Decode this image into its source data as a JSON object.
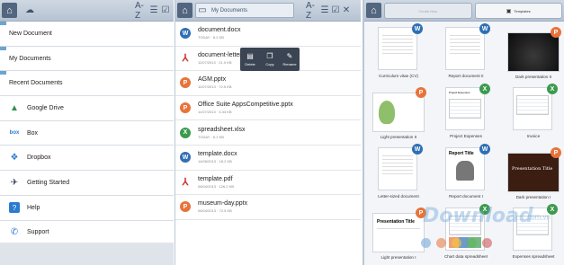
{
  "left": {
    "sections": [
      {
        "label": "New Document"
      },
      {
        "label": "My Documents"
      },
      {
        "label": "Recent Documents"
      }
    ],
    "services": [
      {
        "label": "Google Drive",
        "icon": "google-drive-icon"
      },
      {
        "label": "Box",
        "icon": "box-icon"
      },
      {
        "label": "Dropbox",
        "icon": "dropbox-icon"
      },
      {
        "label": "Getting Started",
        "icon": "person-icon"
      },
      {
        "label": "Help",
        "icon": "help-icon"
      },
      {
        "label": "Support",
        "icon": "phone-icon"
      }
    ],
    "sort_label": "A-Z"
  },
  "middle": {
    "breadcrumb": "My Documents",
    "sort_label": "A-Z",
    "files": [
      {
        "name": "document.docx",
        "meta": "TODAY · 8.2 KB",
        "type": "W"
      },
      {
        "name": "document-letter20",
        "meta": "11/07/2013 · 21.0 KB",
        "type": "PDF"
      },
      {
        "name": "AGM.pptx",
        "meta": "11/07/2013 · 72.5 KB",
        "type": "P"
      },
      {
        "name": "Office Suite AppsCompetitive.pptx",
        "meta": "11/07/2013 · 3.34 KB",
        "type": "P"
      },
      {
        "name": "spreadsheet.xlsx",
        "meta": "TODAY · 6.1 KB",
        "type": "X"
      },
      {
        "name": "template.docx",
        "meta": "14/06/2013 · 18.2 KB",
        "type": "W"
      },
      {
        "name": "template.pdf",
        "meta": "06/04/2013 · 126.2 KB",
        "type": "PDF"
      },
      {
        "name": "museum-day.pptx",
        "meta": "06/04/2013 · 72.5 KB",
        "type": "P"
      }
    ],
    "context_menu": {
      "delete": "Delete",
      "copy": "Copy",
      "rename": "Rename"
    }
  },
  "right": {
    "tab_create": "Create New",
    "tab_templates": "Templates",
    "templates": [
      {
        "label": "Curriculum vitae (CV)",
        "type": "W"
      },
      {
        "label": "Report document II",
        "type": "W"
      },
      {
        "label": "Dark presentation II",
        "type": "P"
      },
      {
        "label": "Light presentation II",
        "type": "P"
      },
      {
        "label": "Project Expenses",
        "type": "X"
      },
      {
        "label": "Invoice",
        "type": "X"
      },
      {
        "label": "Letter-sized document",
        "type": "W"
      },
      {
        "label": "Report document I",
        "type": "W"
      },
      {
        "label": "Dark presentation I",
        "type": "P"
      },
      {
        "label": "Light presentation I",
        "type": "P"
      },
      {
        "label": "Chart data spreadsheet",
        "type": "X"
      },
      {
        "label": "Expenses spreadsheet",
        "type": "X"
      }
    ],
    "thumb_text": {
      "project": "Project Expenses",
      "presentation": "Presentation Title",
      "presentation_sub": "Presentation Subtitle",
      "report": "Report Title"
    }
  },
  "colors": {
    "W": "#2f6fb4",
    "P": "#e8733a",
    "X": "#3c9a4e",
    "PDF": "#c8362f"
  },
  "watermark": {
    "text": "Download",
    "suffix": ".com.vn"
  }
}
